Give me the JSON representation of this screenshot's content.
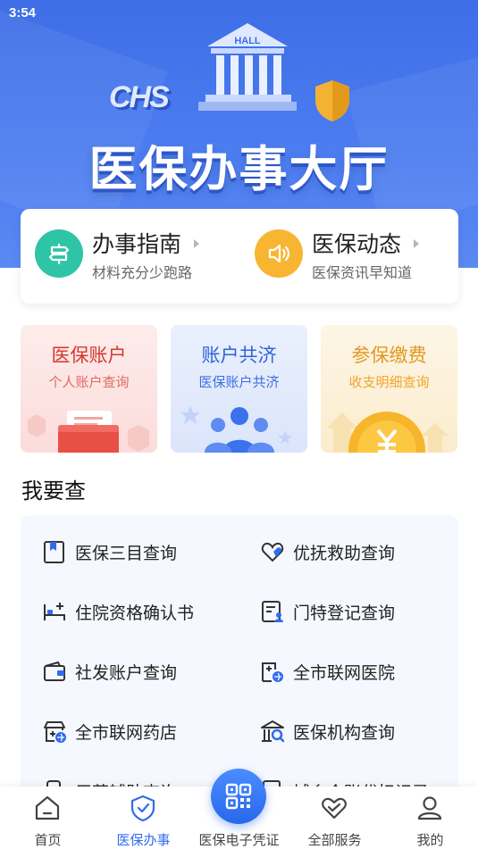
{
  "status_bar": {
    "time": "3:54"
  },
  "hero": {
    "title": "医保办事大厅",
    "badge_text": "CHS",
    "building_text": "HALL"
  },
  "guide": [
    {
      "title": "办事指南",
      "subtitle": "材料充分少跑路",
      "icon": "signpost-icon",
      "color": "#2ec4a6"
    },
    {
      "title": "医保动态",
      "subtitle": "医保资讯早知道",
      "icon": "speaker-icon",
      "color": "#f8b531"
    }
  ],
  "tiles": [
    {
      "title": "医保账户",
      "subtitle": "个人账户查询",
      "title_color": "#d9362f",
      "sub_color": "#e06a63",
      "bg": "#fde9e8",
      "icon": "wallet-icon"
    },
    {
      "title": "账户共济",
      "subtitle": "医保账户共济",
      "title_color": "#2e63d8",
      "sub_color": "#3d6fe0",
      "bg": "#e6edfc",
      "icon": "family-icon"
    },
    {
      "title": "参保缴费",
      "subtitle": "收支明细查询",
      "title_color": "#e09a22",
      "sub_color": "#f1a52a",
      "bg": "#fdf3df",
      "icon": "coin-icon"
    }
  ],
  "section": {
    "title": "我要查"
  },
  "query_items": [
    {
      "label": "医保三目查询",
      "icon": "bookmark-book-icon"
    },
    {
      "label": "优抚救助查询",
      "icon": "heart-hand-icon"
    },
    {
      "label": "住院资格确认书",
      "icon": "hospital-bed-icon"
    },
    {
      "label": "门特登记查询",
      "icon": "register-card-icon"
    },
    {
      "label": "社发账户查询",
      "icon": "wallet-outline-icon"
    },
    {
      "label": "全市联网医院",
      "icon": "hospital-network-icon"
    },
    {
      "label": "全市联网药店",
      "icon": "pharmacy-network-icon"
    },
    {
      "label": "医保机构查询",
      "icon": "institution-search-icon"
    },
    {
      "label": "用药辅助查询",
      "icon": "medicine-icon"
    },
    {
      "label": "城乡个账代扣记录",
      "icon": "deduct-record-icon"
    }
  ],
  "tabs": [
    {
      "label": "首页",
      "icon": "home-icon"
    },
    {
      "label": "医保办事",
      "icon": "shield-check-icon"
    },
    {
      "label": "医保电子凭证",
      "icon": "qr-code-icon"
    },
    {
      "label": "全部服务",
      "icon": "heart-service-icon"
    },
    {
      "label": "我的",
      "icon": "user-icon"
    }
  ],
  "active_tab": "医保办事",
  "colors": {
    "primary": "#2f6cf0",
    "hero": "#4b7cf0"
  }
}
